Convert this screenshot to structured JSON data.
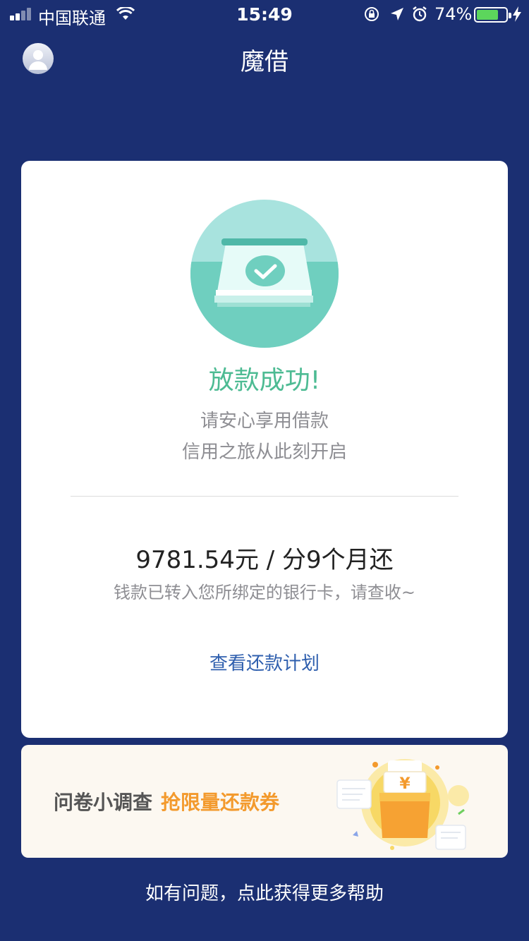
{
  "status_bar": {
    "carrier": "中国联通",
    "time": "15:49",
    "battery_percent": "74%",
    "battery_level": 0.74,
    "battery_color": "#5cd65c"
  },
  "nav": {
    "title": "魔借",
    "avatar_icon": "user-avatar-icon"
  },
  "card": {
    "illustration_icon": "loan-success-check-icon",
    "success_title": "放款成功!",
    "subtitle_line1": "请安心享用借款",
    "subtitle_line2": "信用之旅从此刻开启",
    "amount_text": "9781.54元 / 分9个月还",
    "transfer_note": "钱款已转入您所绑定的银行卡，请查收~",
    "plan_link": "查看还款计划"
  },
  "survey_banner": {
    "label": "问卷小调查",
    "cta": "抢限量还款券",
    "illustration_icon": "coupon-gift-bag-icon"
  },
  "help_link": "如有问题，点此获得更多帮助",
  "colors": {
    "background": "#1b2f72",
    "success_green": "#4dbb93",
    "link_blue": "#2f5fae",
    "cta_orange": "#f39a2d"
  }
}
